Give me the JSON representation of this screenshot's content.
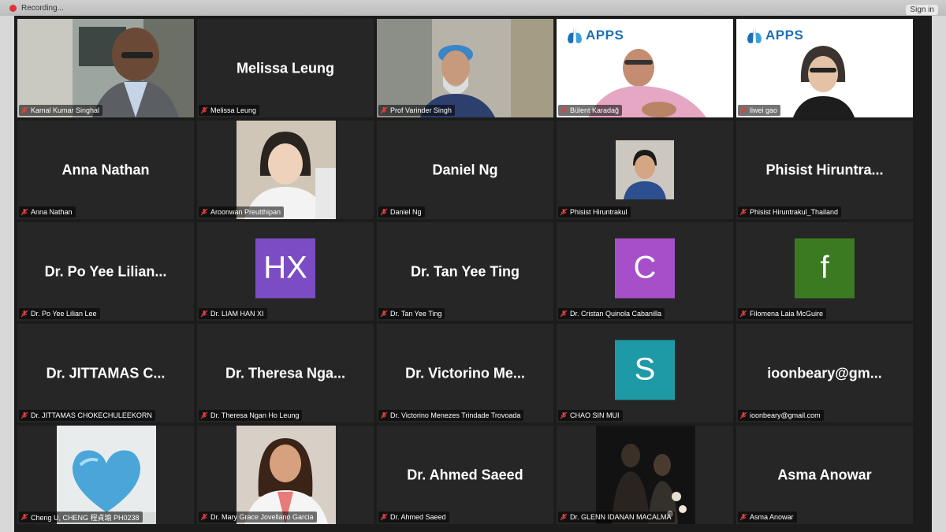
{
  "window": {
    "recording_label": "Recording...",
    "signin_label": "Sign in"
  },
  "colors": {
    "active_speaker": "#e6d25a",
    "tile_bg": "#262626",
    "purple": "#7b4cc4",
    "green": "#3c7a22",
    "teal": "#1e9aa6"
  },
  "icons": {
    "muted_mic": "muted-mic-icon"
  },
  "participants": [
    {
      "label": "Kamal Kumar Singhal",
      "display": "video"
    },
    {
      "label": "Melissa Leung",
      "display_name": "Melissa Leung",
      "display": "name"
    },
    {
      "label": "Prof Varinder Singh",
      "display": "video",
      "active": true
    },
    {
      "label": "Bülent Karadağ",
      "display": "video",
      "logo_text": "APPS"
    },
    {
      "label": "liwei gao",
      "display": "video",
      "logo_text": "APPS"
    },
    {
      "label": "Anna Nathan",
      "display_name": "Anna Nathan",
      "display": "name"
    },
    {
      "label": "Aroonwan Preutthipan",
      "display": "photo"
    },
    {
      "label": "Daniel Ng",
      "display_name": "Daniel Ng",
      "display": "name"
    },
    {
      "label": "Phisist Hiruntrakul",
      "display": "photo"
    },
    {
      "label": "Phisist Hiruntrakul_Thailand",
      "display_name": "Phisist  Hiruntra...",
      "display": "name"
    },
    {
      "label": "Dr. Po Yee Lilian Lee",
      "display_name": "Dr. Po Yee Lilian...",
      "display": "name"
    },
    {
      "label": "Dr. LIAM HAN XI",
      "avatar_text": "HX",
      "display": "avatar"
    },
    {
      "label": "Dr. Tan Yee Ting",
      "display_name": "Dr. Tan Yee Ting",
      "display": "name"
    },
    {
      "label": "Dr. Cristan Quinola Cabanilla",
      "avatar_text": "C",
      "display": "avatar"
    },
    {
      "label": "Filomena Laia McGuire",
      "avatar_text": "f",
      "display": "avatar"
    },
    {
      "label": "Dr. JITTAMAS CHOKECHULEEKORN",
      "display_name": "Dr. JITTAMAS C...",
      "display": "name"
    },
    {
      "label": "Dr. Theresa Ngan Ho Leung",
      "display_name": "Dr.  Theresa Nga...",
      "display": "name"
    },
    {
      "label": "Dr. Victorino Menezes Trindade Trovoada",
      "display_name": "Dr. Victorino Me...",
      "display": "name"
    },
    {
      "label": "CHAO SIN MUI",
      "avatar_text": "S",
      "display": "avatar"
    },
    {
      "label": "ioonbeary@gmail.com",
      "display_name": "ioonbeary@gm...",
      "display": "name"
    },
    {
      "label": "Cheng U, CHENG 程貞瑜 PH0238",
      "display": "photo"
    },
    {
      "label": "Dr. Mary Grace Jovellano Garcia",
      "display": "photo"
    },
    {
      "label": "Dr. Ahmed Saeed",
      "display_name": "Dr. Ahmed Saeed",
      "display": "name"
    },
    {
      "label": "Dr. GLENN IDANAN MACALMA",
      "display": "photo"
    },
    {
      "label": "Asma Anowar",
      "display_name": "Asma Anowar",
      "display": "name"
    }
  ]
}
